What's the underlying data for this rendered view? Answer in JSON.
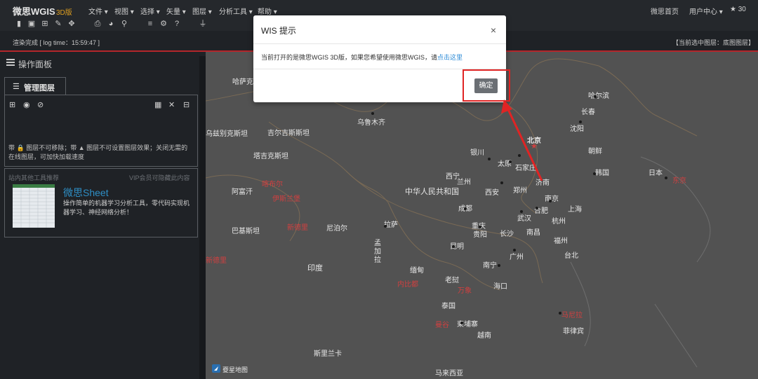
{
  "app": {
    "brand": "微思WGIS",
    "brand_sub": "3D版"
  },
  "menu": [
    "文件 ▾",
    "视图 ▾",
    "选择 ▾",
    "矢量 ▾",
    "图层 ▾",
    "分析工具 ▾",
    "帮助 ▾"
  ],
  "top_right": {
    "home": "微思首页",
    "user_center": "用户中心 ▾",
    "star_count": "30"
  },
  "toolbar_icons": [
    "new-file-icon",
    "save-icon",
    "add-icon",
    "edit-icon",
    "move-icon",
    "layers-icon",
    "palette-icon",
    "search-icon",
    "stack-icon",
    "gear-icon",
    "help-icon",
    "plugin-icon"
  ],
  "status": {
    "left": "渲染完成 [ log time：15:59:47 ]",
    "right": "【当前选中图层：底图图层】"
  },
  "panel": {
    "title": "操作面板",
    "tab_label": "管理图层",
    "hint": "带 🔒 图层不可移除；带 ▲ 图层不可设置图层效果；关闭无需的在线图层，可加快加载速度",
    "tool_head_left": "站内其他工具推荐",
    "tool_head_right": "VIP会员可隐藏此内容",
    "tool_title": "微思Sheet",
    "tool_desc": "操作简单的机器学习分析工具，零代码实现机器学习、神经网络分析！"
  },
  "map": {
    "credit": "夒星地图",
    "labels": [
      {
        "t": "哈萨克斯坦",
        "red": false
      },
      {
        "t": "乌鲁木齐",
        "red": false
      },
      {
        "t": "哈尔滨",
        "red": false
      },
      {
        "t": "长春",
        "red": false
      },
      {
        "t": "沈阳",
        "red": false
      },
      {
        "t": "乌兹别克斯坦",
        "red": false
      },
      {
        "t": "吉尔吉斯斯坦",
        "red": false
      },
      {
        "t": "北京",
        "red": false
      },
      {
        "t": "朝鲜",
        "red": false
      },
      {
        "t": "塔吉克斯坦",
        "red": false
      },
      {
        "t": "银川",
        "red": false
      },
      {
        "t": "太原",
        "red": false
      },
      {
        "t": "石家庄",
        "red": false
      },
      {
        "t": "济南",
        "red": false
      },
      {
        "t": "韩国",
        "red": false
      },
      {
        "t": "日本",
        "red": false
      },
      {
        "t": "东京",
        "red": true
      },
      {
        "t": "喀布尔",
        "red": true
      },
      {
        "t": "西宁",
        "red": false
      },
      {
        "t": "兰州",
        "red": false
      },
      {
        "t": "阿富汗",
        "red": false
      },
      {
        "t": "伊斯兰堡",
        "red": true
      },
      {
        "t": "中华人民共和国",
        "red": false
      },
      {
        "t": "西安",
        "red": false
      },
      {
        "t": "郑州",
        "red": false
      },
      {
        "t": "南京",
        "red": false
      },
      {
        "t": "合肥",
        "red": false
      },
      {
        "t": "上海",
        "red": false
      },
      {
        "t": "成都",
        "red": false
      },
      {
        "t": "武汉",
        "red": false
      },
      {
        "t": "杭州",
        "red": false
      },
      {
        "t": "巴基斯坦",
        "red": false
      },
      {
        "t": "新德里",
        "red": true
      },
      {
        "t": "尼泊尔",
        "red": false
      },
      {
        "t": "拉萨",
        "red": false
      },
      {
        "t": "重庆",
        "red": false
      },
      {
        "t": "长沙",
        "red": false
      },
      {
        "t": "南昌",
        "red": false
      },
      {
        "t": "贵阳",
        "red": false
      },
      {
        "t": "福州",
        "red": false
      },
      {
        "t": "台北",
        "red": false
      },
      {
        "t": "孟加拉",
        "red": false
      },
      {
        "t": "昆明",
        "red": false
      },
      {
        "t": "广州",
        "red": false
      },
      {
        "t": "南宁",
        "red": false
      },
      {
        "t": "新德里",
        "red": false
      },
      {
        "t": "印度",
        "red": false
      },
      {
        "t": "缅甸",
        "red": false
      },
      {
        "t": "老挝",
        "red": false
      },
      {
        "t": "内比都",
        "red": true
      },
      {
        "t": "万象",
        "red": true
      },
      {
        "t": "海口",
        "red": false
      },
      {
        "t": "泰国",
        "red": false
      },
      {
        "t": "马尼拉",
        "red": true
      },
      {
        "t": "曼谷",
        "red": true
      },
      {
        "t": "柬埔寨",
        "red": false
      },
      {
        "t": "越南",
        "red": false
      },
      {
        "t": "菲律宾",
        "red": false
      },
      {
        "t": "斯里兰卡",
        "red": false
      },
      {
        "t": "马来西亚",
        "red": false
      }
    ]
  },
  "dialog": {
    "title": "WIS 提示",
    "close": "×",
    "message": "当前打开的是微思WGIS 3D版，如果您希望使用微思WGIS，请",
    "link": "点击这里",
    "ok": "确定"
  }
}
